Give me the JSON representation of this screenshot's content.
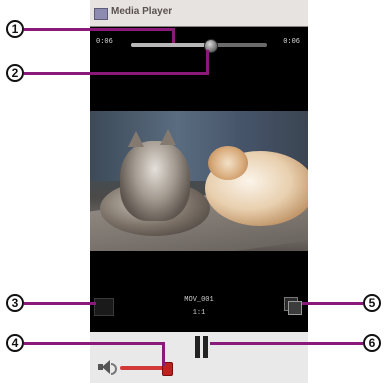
{
  "window": {
    "title": "Media Player"
  },
  "seekbar": {
    "elapsed": "0:06",
    "total": "0:06",
    "progress_fraction": 0.58
  },
  "now_playing": {
    "filename": "MOV_001",
    "position": "1:1"
  },
  "volume": {
    "level_fraction": 0.75
  },
  "callouts": [
    "1",
    "2",
    "3",
    "4",
    "5",
    "6"
  ],
  "colors": {
    "leader": "#8a1a7a",
    "titlebar": "#e7e3e1",
    "volume_accent": "#d23a3a"
  }
}
